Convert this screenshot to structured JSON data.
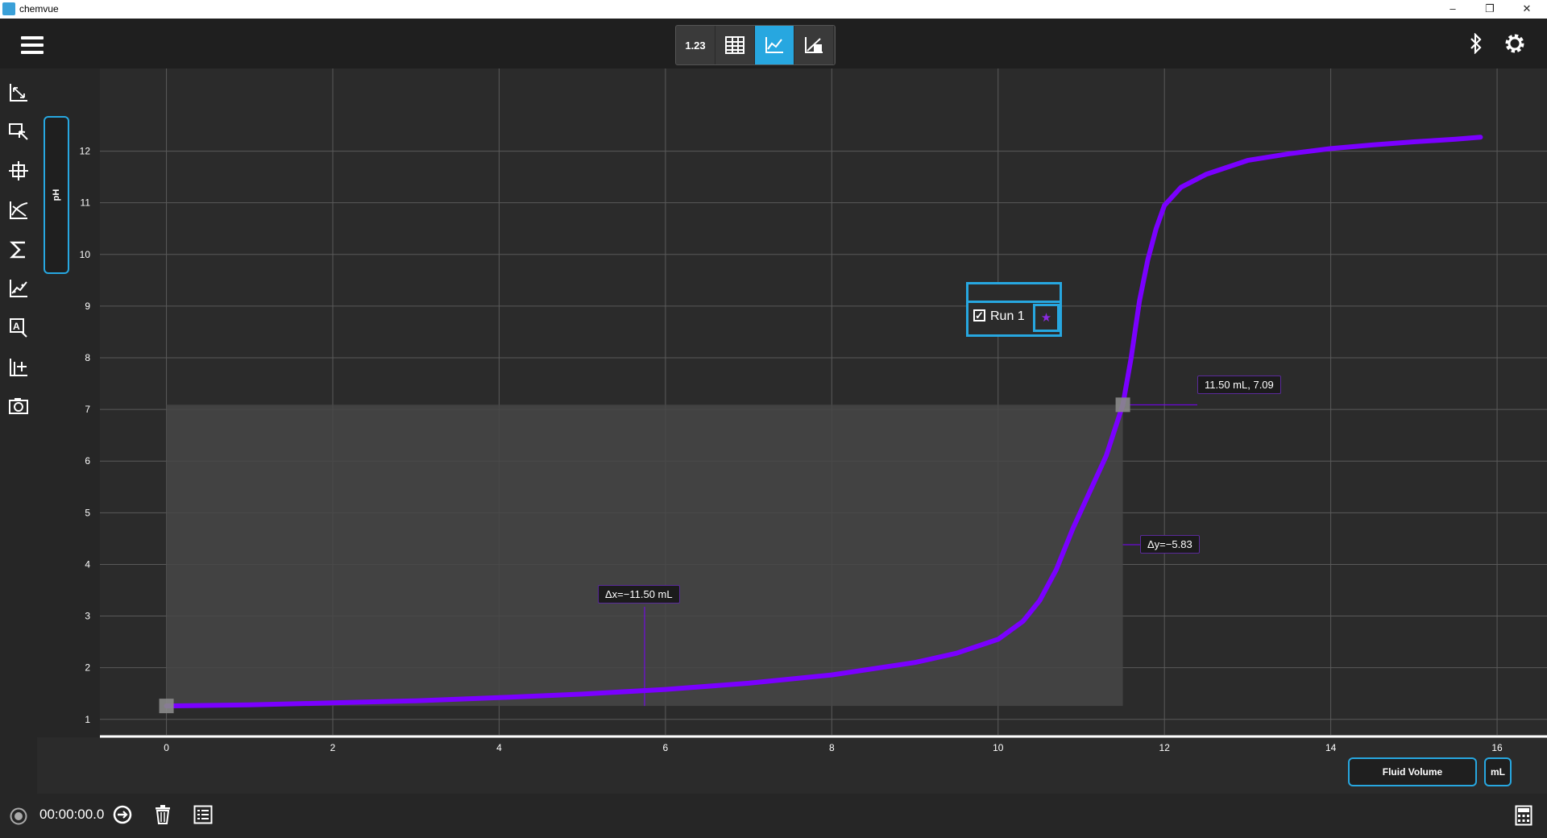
{
  "window": {
    "title": "chemvue",
    "minimize": "–",
    "restore": "❐",
    "close": "✕"
  },
  "modes": [
    {
      "label": "1.23",
      "icon": "meter-icon",
      "active": false
    },
    {
      "label": "",
      "icon": "table-icon",
      "active": false
    },
    {
      "label": "",
      "icon": "graph-icon",
      "active": true
    },
    {
      "label": "",
      "icon": "graph-table-icon",
      "active": false
    }
  ],
  "toolbar_right": {
    "bluetooth": "bluetooth-icon",
    "settings": "gear-icon"
  },
  "sidebar_tools": [
    "autoscale-icon",
    "select-region-icon",
    "examine-icon",
    "tangent-icon",
    "statistics-icon",
    "curve-fit-icon",
    "annotation-icon",
    "add-axis-icon",
    "camera-icon"
  ],
  "y_axis_label": "pH",
  "x_axis_label": "Fluid Volume",
  "x_axis_unit": "mL",
  "legend": {
    "run_name": "Run 1",
    "checked": true,
    "marker": "★"
  },
  "annotations": {
    "point": "11.50 mL, 7.09",
    "dy": "Δy=−5.83",
    "dx": "Δx=−11.50 mL"
  },
  "timer": "00:00:00.0",
  "colors": {
    "accent": "#27a7e0",
    "series": "#7a00ff",
    "selection": "#444444"
  },
  "chart_data": {
    "type": "line",
    "xlabel": "Fluid Volume",
    "ylabel": "pH",
    "xlim": [
      -0.8,
      16.6
    ],
    "ylim": [
      0.7,
      13.6
    ],
    "xticks": [
      0,
      2,
      4,
      6,
      8,
      10,
      12,
      14,
      16
    ],
    "yticks": [
      1,
      2,
      3,
      4,
      5,
      6,
      7,
      8,
      9,
      10,
      11,
      12
    ],
    "grid": true,
    "selection": {
      "x": [
        0,
        11.5
      ],
      "y": [
        1.26,
        7.09
      ]
    },
    "series": [
      {
        "name": "Run 1",
        "x": [
          0,
          1,
          2,
          3,
          4,
          5,
          6,
          7,
          8,
          9,
          9.5,
          10,
          10.3,
          10.5,
          10.7,
          10.9,
          11.1,
          11.3,
          11.5,
          11.6,
          11.7,
          11.8,
          11.9,
          12.0,
          12.2,
          12.5,
          13,
          13.5,
          14,
          14.5,
          15,
          15.5,
          15.8
        ],
        "y": [
          1.26,
          1.28,
          1.32,
          1.36,
          1.42,
          1.49,
          1.58,
          1.7,
          1.86,
          2.1,
          2.28,
          2.55,
          2.9,
          3.3,
          3.9,
          4.7,
          5.4,
          6.1,
          7.09,
          8.0,
          9.1,
          9.9,
          10.5,
          10.95,
          11.3,
          11.55,
          11.82,
          11.95,
          12.05,
          12.12,
          12.18,
          12.23,
          12.27
        ]
      }
    ]
  }
}
